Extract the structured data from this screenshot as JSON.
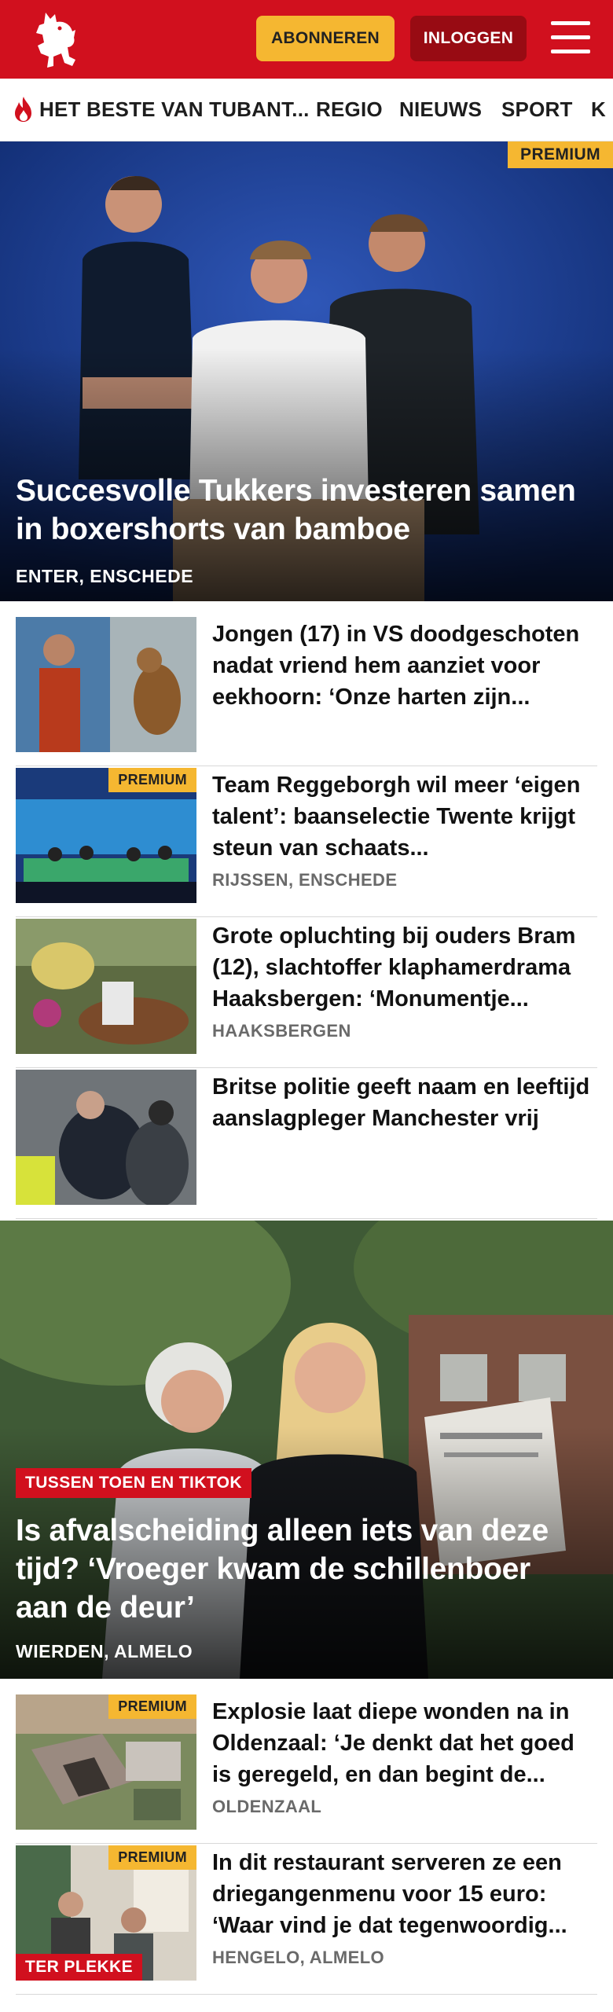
{
  "header": {
    "subscribe_label": "ABONNEREN",
    "login_label": "INLOGGEN",
    "brand_color": "#d1101e",
    "logo_icon": "horse-logo-icon",
    "menu_icon": "hamburger-menu-icon"
  },
  "nav": {
    "items": [
      "HET BESTE VAN TUBANT...",
      "REGIO",
      "NIEUWS",
      "SPORT",
      "K"
    ],
    "featured_icon": "flame-icon"
  },
  "hero1": {
    "badge": "PREMIUM",
    "title": "Succesvolle Tukkers investeren samen in boxershorts van bamboe",
    "location": "ENTER, ENSCHEDE"
  },
  "articles1": [
    {
      "title": "Jongen (17) in VS doodgeschoten nadat vriend hem aanziet voor eekhoorn: ‘Onze harten zijn...",
      "premium": "",
      "location": ""
    },
    {
      "title": "Team Reggeborgh wil meer ‘eigen talent’: baanselectie Twente krijgt steun van schaats...",
      "premium": "PREMIUM",
      "location": "RIJSSEN, ENSCHEDE"
    },
    {
      "title": "Grote opluchting bij ouders Bram (12), slachtoffer klaphamerdra­ma Haaksbergen: ‘Monumentje...",
      "premium": "",
      "location": "HAAKSBERGEN"
    },
    {
      "title": "Britse politie geeft naam en leeftijd aanslagpleger Manchester vrij",
      "premium": "",
      "location": ""
    }
  ],
  "hero2": {
    "series": "TUSSEN TOEN EN TIKTOK",
    "title": "Is afvalscheiding alleen iets van deze tijd? ‘Vroeger kwam de schillenboer aan de deur’",
    "location": "WIERDEN, ALMELO"
  },
  "articles2": [
    {
      "title": "Explosie laat diepe wonden na in Oldenzaal: ‘Je denkt dat het goed is geregeld, en dan begint de...",
      "premium": "PREMIUM",
      "location": "OLDENZAAL",
      "tag": ""
    },
    {
      "title": "In dit restaurant serveren ze een driegangenmenu voor 15 euro: ‘Waar vind je dat tegenwoordig...",
      "premium": "PREMIUM",
      "location": "HENGELO, ALMELO",
      "tag": "TER PLEKKE"
    }
  ]
}
